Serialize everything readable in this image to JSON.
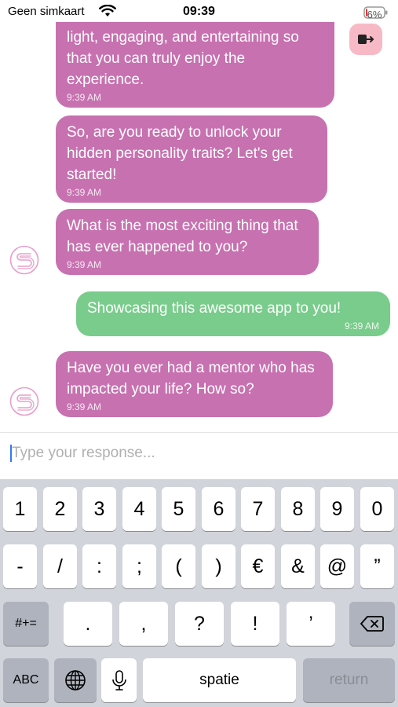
{
  "status_bar": {
    "carrier": "Geen simkaart",
    "time": "09:39",
    "battery": "6%"
  },
  "colors": {
    "bot_bubble": "#c771b0",
    "user_bubble": "#79cc8b",
    "logout_button": "#f7b9c5"
  },
  "messages": [
    {
      "sender": "bot",
      "text": "light, engaging, and entertaining so that you can truly enjoy the experience.",
      "time": "9:39 AM"
    },
    {
      "sender": "bot",
      "text": "So, are you ready to unlock your hidden personality traits? Let's get started!",
      "time": "9:39 AM"
    },
    {
      "sender": "bot",
      "text": "What is the most exciting thing that has ever happened to you?",
      "time": "9:39 AM"
    },
    {
      "sender": "user",
      "text": "Showcasing this awesome app to you!",
      "time": "9:39 AM"
    },
    {
      "sender": "bot",
      "text": "Have you ever had a mentor who has impacted your life? How so?",
      "time": "9:39 AM"
    }
  ],
  "input": {
    "placeholder": "Type your response...",
    "value": ""
  },
  "keyboard": {
    "row1": [
      "1",
      "2",
      "3",
      "4",
      "5",
      "6",
      "7",
      "8",
      "9",
      "0"
    ],
    "row2": [
      "-",
      "/",
      ":",
      ";",
      "(",
      ")",
      "€",
      "&",
      "@",
      "”"
    ],
    "row3_toggle": "#+=",
    "row3": [
      ".",
      ",",
      "?",
      "!",
      "’"
    ],
    "abc": "ABC",
    "space": "spatie",
    "return": "return"
  },
  "icons": {
    "logout": "logout-icon",
    "avatar": "bot-avatar-s-logo",
    "backspace": "backspace-icon",
    "globe": "globe-icon",
    "mic": "microphone-icon"
  }
}
